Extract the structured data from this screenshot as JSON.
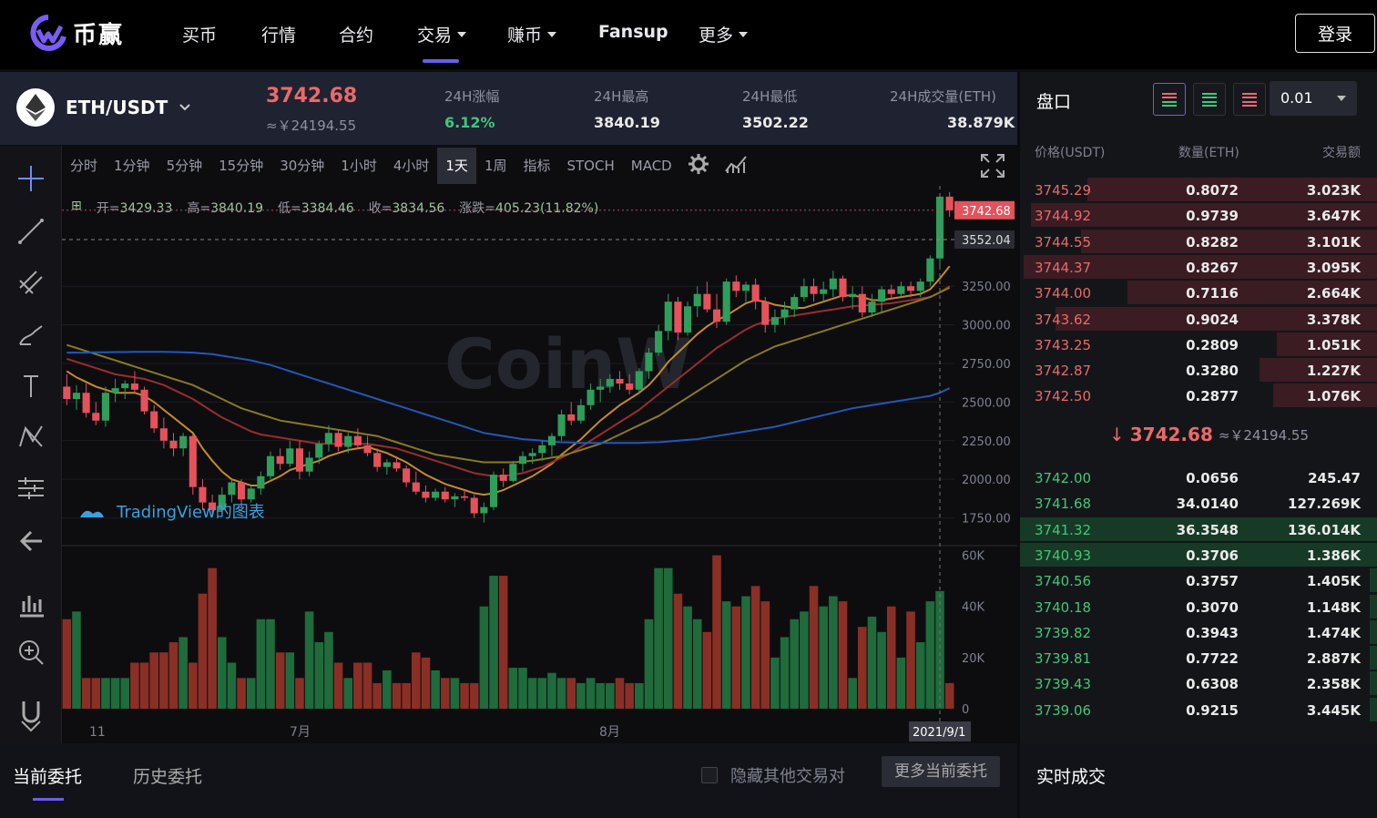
{
  "nav": {
    "brand": "币赢",
    "items": [
      {
        "label": "买币",
        "dropdown": false
      },
      {
        "label": "行情",
        "dropdown": false
      },
      {
        "label": "合约",
        "dropdown": false
      },
      {
        "label": "交易",
        "dropdown": true
      },
      {
        "label": "赚币",
        "dropdown": true
      },
      {
        "label": "Fansup",
        "dropdown": false
      },
      {
        "label": "更多",
        "dropdown": true
      }
    ],
    "active_item": "交易",
    "login": "登录"
  },
  "ticker": {
    "pair": "ETH/USDT",
    "price": "3742.68",
    "cny": "≈￥24194.55",
    "stats": [
      {
        "label": "24H涨幅",
        "value": "6.12%",
        "color": "#40c778"
      },
      {
        "label": "24H最高",
        "value": "3840.19",
        "color": "#eaeaea"
      },
      {
        "label": "24H最低",
        "value": "3502.22",
        "color": "#eaeaea"
      },
      {
        "label": "24H成交量(ETH)",
        "value": "38.879K",
        "color": "#eaeaea"
      }
    ]
  },
  "chart": {
    "timeframes": [
      "分时",
      "1分钟",
      "5分钟",
      "15分钟",
      "30分钟",
      "1小时",
      "4小时",
      "1天",
      "1周"
    ],
    "active_timeframe": "1天",
    "indicators": [
      "指标",
      "STOCH",
      "MACD"
    ],
    "ohlc": {
      "open": "3429.33",
      "high": "3840.19",
      "low": "3384.46",
      "close": "3834.56",
      "change": "405.23(11.82%)"
    },
    "ohlc_labels": {
      "open": "开=",
      "high": "高=",
      "low": "低=",
      "close": "收=",
      "change": "涨跌="
    },
    "watermark": "CoinW",
    "tv_label": "TradingView的图表",
    "price_ticks": [
      "3250.00",
      "3000.00",
      "2750.00",
      "2500.00",
      "2250.00",
      "2000.00",
      "1750.00"
    ],
    "volume_ticks": [
      "60K",
      "40K",
      "20K",
      "0"
    ],
    "date_ticks": [
      "11",
      "7月",
      "8月"
    ],
    "cursor_date": "2021/9/1",
    "last_price_label": "3742.68",
    "cross_price_label": "3552.04"
  },
  "chart_data": {
    "type": "candlestick",
    "ylim": [
      1600,
      3900
    ],
    "candles": [
      [
        2600,
        2680,
        2480,
        2520
      ],
      [
        2520,
        2610,
        2450,
        2560
      ],
      [
        2560,
        2620,
        2400,
        2430
      ],
      [
        2430,
        2500,
        2350,
        2380
      ],
      [
        2380,
        2600,
        2340,
        2560
      ],
      [
        2560,
        2650,
        2500,
        2590
      ],
      [
        2590,
        2640,
        2520,
        2620
      ],
      [
        2620,
        2700,
        2560,
        2580
      ],
      [
        2580,
        2600,
        2420,
        2440
      ],
      [
        2440,
        2480,
        2300,
        2330
      ],
      [
        2330,
        2400,
        2200,
        2250
      ],
      [
        2250,
        2300,
        2150,
        2200
      ],
      [
        2200,
        2300,
        2150,
        2280
      ],
      [
        2280,
        2290,
        1900,
        1950
      ],
      [
        1950,
        2000,
        1800,
        1850
      ],
      [
        1850,
        1900,
        1780,
        1800
      ],
      [
        1800,
        1950,
        1780,
        1900
      ],
      [
        1900,
        2000,
        1850,
        1980
      ],
      [
        1980,
        2000,
        1820,
        1870
      ],
      [
        1870,
        1960,
        1850,
        1940
      ],
      [
        1940,
        2050,
        1900,
        2020
      ],
      [
        2020,
        2180,
        2000,
        2150
      ],
      [
        2150,
        2200,
        2060,
        2100
      ],
      [
        2100,
        2250,
        2080,
        2200
      ],
      [
        2200,
        2250,
        2000,
        2050
      ],
      [
        2050,
        2180,
        2020,
        2140
      ],
      [
        2140,
        2250,
        2100,
        2230
      ],
      [
        2230,
        2350,
        2180,
        2300
      ],
      [
        2300,
        2320,
        2180,
        2210
      ],
      [
        2210,
        2300,
        2170,
        2280
      ],
      [
        2280,
        2330,
        2200,
        2220
      ],
      [
        2220,
        2280,
        2150,
        2170
      ],
      [
        2170,
        2200,
        2050,
        2080
      ],
      [
        2080,
        2130,
        2030,
        2110
      ],
      [
        2110,
        2150,
        2050,
        2070
      ],
      [
        2070,
        2090,
        1950,
        1980
      ],
      [
        1980,
        2050,
        1900,
        1920
      ],
      [
        1920,
        1960,
        1850,
        1880
      ],
      [
        1880,
        1940,
        1860,
        1920
      ],
      [
        1920,
        1950,
        1850,
        1870
      ],
      [
        1870,
        1910,
        1820,
        1890
      ],
      [
        1890,
        1930,
        1860,
        1880
      ],
      [
        1880,
        1900,
        1750,
        1780
      ],
      [
        1780,
        1850,
        1720,
        1820
      ],
      [
        1820,
        2050,
        1800,
        2030
      ],
      [
        2030,
        2070,
        1950,
        1990
      ],
      [
        1990,
        2120,
        1980,
        2100
      ],
      [
        2100,
        2180,
        2050,
        2150
      ],
      [
        2150,
        2200,
        2100,
        2170
      ],
      [
        2170,
        2250,
        2120,
        2220
      ],
      [
        2220,
        2300,
        2150,
        2280
      ],
      [
        2280,
        2450,
        2250,
        2420
      ],
      [
        2420,
        2500,
        2350,
        2380
      ],
      [
        2380,
        2520,
        2360,
        2480
      ],
      [
        2480,
        2620,
        2450,
        2580
      ],
      [
        2580,
        2650,
        2500,
        2600
      ],
      [
        2600,
        2680,
        2560,
        2650
      ],
      [
        2650,
        2700,
        2580,
        2620
      ],
      [
        2620,
        2680,
        2550,
        2580
      ],
      [
        2580,
        2720,
        2560,
        2700
      ],
      [
        2700,
        2850,
        2650,
        2820
      ],
      [
        2820,
        3000,
        2800,
        2960
      ],
      [
        2960,
        3200,
        2900,
        3150
      ],
      [
        3150,
        3180,
        2900,
        2950
      ],
      [
        2950,
        3150,
        2930,
        3120
      ],
      [
        3120,
        3250,
        3050,
        3200
      ],
      [
        3200,
        3280,
        3080,
        3100
      ],
      [
        3100,
        3200,
        2980,
        3020
      ],
      [
        3020,
        3300,
        3000,
        3280
      ],
      [
        3280,
        3320,
        3180,
        3220
      ],
      [
        3220,
        3280,
        3150,
        3260
      ],
      [
        3260,
        3300,
        3100,
        3150
      ],
      [
        3150,
        3180,
        2950,
        3000
      ],
      [
        3000,
        3100,
        2950,
        3050
      ],
      [
        3050,
        3150,
        3000,
        3100
      ],
      [
        3100,
        3200,
        3050,
        3180
      ],
      [
        3180,
        3300,
        3150,
        3250
      ],
      [
        3250,
        3300,
        3150,
        3200
      ],
      [
        3200,
        3280,
        3150,
        3230
      ],
      [
        3230,
        3350,
        3180,
        3300
      ],
      [
        3300,
        3320,
        3150,
        3180
      ],
      [
        3180,
        3250,
        3100,
        3200
      ],
      [
        3200,
        3250,
        3050,
        3080
      ],
      [
        3080,
        3200,
        3050,
        3150
      ],
      [
        3150,
        3250,
        3080,
        3230
      ],
      [
        3230,
        3260,
        3170,
        3200
      ],
      [
        3200,
        3280,
        3180,
        3250
      ],
      [
        3250,
        3280,
        3180,
        3220
      ],
      [
        3220,
        3300,
        3180,
        3280
      ],
      [
        3280,
        3450,
        3250,
        3430
      ],
      [
        3430,
        3850,
        3380,
        3830
      ],
      [
        3830,
        3860,
        3700,
        3742
      ]
    ],
    "volumes": [
      35,
      38,
      12,
      12,
      12,
      12,
      12,
      18,
      18,
      22,
      22,
      26,
      28,
      18,
      45,
      55,
      28,
      18,
      12,
      12,
      35,
      35,
      22,
      22,
      12,
      38,
      26,
      30,
      18,
      12,
      18,
      18,
      10,
      15,
      10,
      10,
      22,
      20,
      15,
      12,
      12,
      10,
      10,
      40,
      52,
      52,
      16,
      16,
      12,
      12,
      14,
      12,
      12,
      10,
      12,
      10,
      10,
      12,
      10,
      10,
      35,
      55,
      55,
      45,
      40,
      35,
      30,
      60,
      42,
      40,
      44,
      48,
      42,
      20,
      28,
      35,
      38,
      48,
      40,
      44,
      42,
      12,
      32,
      36,
      30,
      40,
      20,
      38,
      26,
      42,
      46,
      10
    ],
    "ma_short": [
      2700,
      2660,
      2630,
      2600,
      2580,
      2560,
      2560,
      2560,
      2540,
      2500,
      2450,
      2400,
      2350,
      2300,
      2200,
      2120,
      2050,
      2000,
      1980,
      1960,
      1960,
      1990,
      2020,
      2060,
      2080,
      2100,
      2120,
      2150,
      2170,
      2190,
      2200,
      2210,
      2190,
      2170,
      2140,
      2110,
      2070,
      2030,
      2000,
      1970,
      1950,
      1930,
      1910,
      1900,
      1910,
      1930,
      1960,
      1990,
      2020,
      2060,
      2100,
      2160,
      2210,
      2260,
      2320,
      2380,
      2430,
      2480,
      2520,
      2560,
      2610,
      2680,
      2760,
      2820,
      2880,
      2940,
      2990,
      3030,
      3060,
      3100,
      3140,
      3160,
      3150,
      3130,
      3120,
      3110,
      3110,
      3130,
      3150,
      3170,
      3190,
      3190,
      3180,
      3160,
      3160,
      3170,
      3180,
      3190,
      3200,
      3230,
      3300,
      3380
    ],
    "ma_mid": [
      2780,
      2760,
      2740,
      2720,
      2700,
      2680,
      2670,
      2660,
      2650,
      2630,
      2610,
      2580,
      2550,
      2520,
      2480,
      2440,
      2400,
      2370,
      2340,
      2310,
      2290,
      2280,
      2270,
      2260,
      2250,
      2240,
      2230,
      2230,
      2230,
      2230,
      2230,
      2230,
      2220,
      2210,
      2200,
      2180,
      2160,
      2140,
      2120,
      2100,
      2080,
      2060,
      2040,
      2030,
      2020,
      2020,
      2030,
      2040,
      2060,
      2080,
      2110,
      2140,
      2170,
      2210,
      2250,
      2290,
      2330,
      2370,
      2410,
      2450,
      2500,
      2550,
      2600,
      2650,
      2700,
      2750,
      2800,
      2850,
      2890,
      2930,
      2970,
      3000,
      3020,
      3040,
      3050,
      3060,
      3070,
      3080,
      3090,
      3100,
      3110,
      3120,
      3125,
      3130,
      3135,
      3140,
      3150,
      3160,
      3170,
      3180,
      3210,
      3250
    ],
    "ma_long": [
      2870,
      2850,
      2830,
      2810,
      2790,
      2770,
      2750,
      2730,
      2710,
      2690,
      2670,
      2650,
      2630,
      2610,
      2580,
      2550,
      2520,
      2490,
      2460,
      2440,
      2420,
      2400,
      2380,
      2370,
      2360,
      2350,
      2340,
      2330,
      2320,
      2310,
      2300,
      2290,
      2280,
      2260,
      2240,
      2220,
      2200,
      2180,
      2160,
      2150,
      2140,
      2130,
      2120,
      2110,
      2110,
      2110,
      2110,
      2115,
      2120,
      2130,
      2140,
      2150,
      2170,
      2190,
      2210,
      2230,
      2260,
      2290,
      2320,
      2350,
      2380,
      2410,
      2450,
      2490,
      2530,
      2570,
      2610,
      2650,
      2690,
      2730,
      2770,
      2800,
      2830,
      2860,
      2880,
      2900,
      2920,
      2940,
      2960,
      2980,
      3000,
      3020,
      3040,
      3060,
      3080,
      3100,
      3120,
      3140,
      3160,
      3180,
      3210,
      3240
    ],
    "ma_xlong": [
      2820,
      2820,
      2820,
      2822,
      2822,
      2824,
      2824,
      2825,
      2825,
      2825,
      2825,
      2824,
      2822,
      2820,
      2815,
      2810,
      2800,
      2790,
      2780,
      2770,
      2755,
      2740,
      2720,
      2700,
      2680,
      2660,
      2640,
      2620,
      2600,
      2580,
      2560,
      2540,
      2520,
      2500,
      2480,
      2460,
      2440,
      2420,
      2400,
      2380,
      2360,
      2340,
      2320,
      2300,
      2290,
      2280,
      2270,
      2260,
      2255,
      2250,
      2245,
      2240,
      2238,
      2236,
      2235,
      2235,
      2235,
      2235,
      2235,
      2236,
      2238,
      2240,
      2245,
      2250,
      2255,
      2260,
      2270,
      2280,
      2290,
      2300,
      2310,
      2320,
      2330,
      2340,
      2355,
      2370,
      2385,
      2400,
      2415,
      2430,
      2445,
      2460,
      2470,
      2480,
      2490,
      2500,
      2510,
      2520,
      2530,
      2540,
      2560,
      2590
    ],
    "colors": {
      "up": "#2f9e5b",
      "down": "#e5525c"
    }
  },
  "orderbook": {
    "title": "盘口",
    "precision": "0.01",
    "headers": [
      "价格(USDT)",
      "数量(ETH)",
      "交易额"
    ],
    "asks": [
      {
        "price": "3745.29",
        "qty": "0.8072",
        "total": "3.023K",
        "depth": 0.81
      },
      {
        "price": "3744.92",
        "qty": "0.9739",
        "total": "3.647K",
        "depth": 0.97
      },
      {
        "price": "3744.55",
        "qty": "0.8282",
        "total": "3.101K",
        "depth": 0.83
      },
      {
        "price": "3744.37",
        "qty": "0.8267",
        "total": "3.095K",
        "depth": 0.99
      },
      {
        "price": "3744.00",
        "qty": "0.7116",
        "total": "2.664K",
        "depth": 0.7
      },
      {
        "price": "3743.62",
        "qty": "0.9024",
        "total": "3.378K",
        "depth": 0.9
      },
      {
        "price": "3743.25",
        "qty": "0.2809",
        "total": "1.051K",
        "depth": 0.28
      },
      {
        "price": "3742.87",
        "qty": "0.3280",
        "total": "1.227K",
        "depth": 0.33
      },
      {
        "price": "3742.50",
        "qty": "0.2877",
        "total": "1.076K",
        "depth": 0.29
      }
    ],
    "mid_price": "3742.68",
    "mid_cny": "≈￥24194.55",
    "bids": [
      {
        "price": "3742.00",
        "qty": "0.0656",
        "total": "245.47",
        "depth": 0.0
      },
      {
        "price": "3741.68",
        "qty": "34.0140",
        "total": "127.269K",
        "depth": 0.0
      },
      {
        "price": "3741.32",
        "qty": "36.3548",
        "total": "136.014K",
        "depth": 1.0
      },
      {
        "price": "3740.93",
        "qty": "0.3706",
        "total": "1.386K",
        "depth": 1.0
      },
      {
        "price": "3740.56",
        "qty": "0.3757",
        "total": "1.405K",
        "depth": 0.02
      },
      {
        "price": "3740.18",
        "qty": "0.3070",
        "total": "1.148K",
        "depth": 0.02
      },
      {
        "price": "3739.82",
        "qty": "0.3943",
        "total": "1.474K",
        "depth": 0.02
      },
      {
        "price": "3739.81",
        "qty": "0.7722",
        "total": "2.887K",
        "depth": 0.02
      },
      {
        "price": "3739.43",
        "qty": "0.6308",
        "total": "2.358K",
        "depth": 0.02
      },
      {
        "price": "3739.06",
        "qty": "0.9215",
        "total": "3.445K",
        "depth": 0.02
      }
    ]
  },
  "orders": {
    "tabs": [
      "当前委托",
      "历史委托"
    ],
    "hide_label": "隐藏其他交易对",
    "more_button": "更多当前委托"
  },
  "trades": {
    "title": "实时成交"
  }
}
